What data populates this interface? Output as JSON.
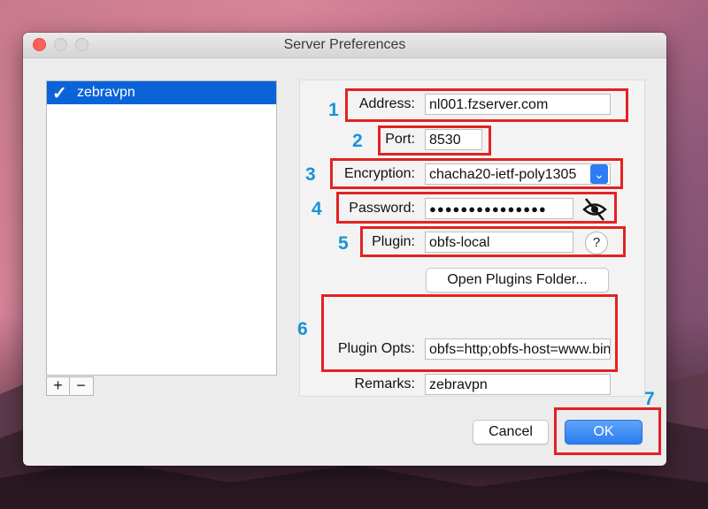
{
  "window": {
    "title": "Server Preferences"
  },
  "server_list": {
    "items": [
      {
        "label": "zebravpn",
        "selected": true
      }
    ],
    "add_label": "+",
    "remove_label": "−"
  },
  "form": {
    "address": {
      "label": "Address:",
      "value": "nl001.fzserver.com"
    },
    "port": {
      "label": "Port:",
      "value": "8530"
    },
    "encryption": {
      "label": "Encryption:",
      "value": "chacha20-ietf-poly1305"
    },
    "password": {
      "label": "Password:",
      "value": "●●●●●●●●●●●●●●●"
    },
    "plugin": {
      "label": "Plugin:",
      "value": "obfs-local",
      "help": "?"
    },
    "open_plugins_folder": "Open Plugins Folder...",
    "plugin_opts": {
      "label": "Plugin Opts:",
      "value": "obfs=http;obfs-host=www.bing.com"
    },
    "remarks": {
      "label": "Remarks:",
      "value": "zebravpn"
    }
  },
  "footer": {
    "cancel_label": "Cancel",
    "ok_label": "OK"
  },
  "annotations": [
    "1",
    "2",
    "3",
    "4",
    "5",
    "6",
    "7"
  ],
  "colors": {
    "annotation_box": "#e32222",
    "annotation_number": "#1993d4",
    "selection": "#0b63d9",
    "accent": "#2a7cf0"
  }
}
